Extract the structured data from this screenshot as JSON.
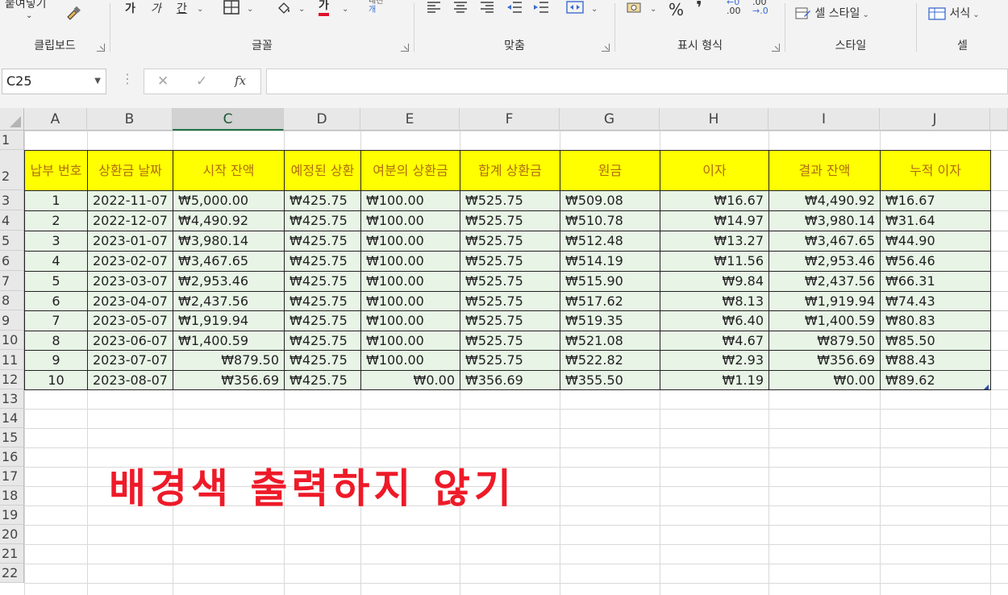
{
  "ribbon": {
    "paste_label": "붙여넣기",
    "groups": {
      "clipboard": "클립보드",
      "font": "글꼴",
      "alignment": "맞춤",
      "number": "표시 형식",
      "styles": "스타일",
      "cells": "셀"
    },
    "font_buttons": {
      "bold": "가",
      "italic": "가",
      "underline": "간",
      "font_color": "가"
    },
    "wrap_label": "내천",
    "number_buttons": {
      "percent": "%",
      "comma": "❜",
      "inc_decimal": ".00",
      "dec_decimal": ".00"
    },
    "cell_style_label": "셀 스타일",
    "format_label": "서식"
  },
  "formula_bar": {
    "name_box": "C25",
    "fx": "fx",
    "cancel": "✕",
    "enter": "✓",
    "value": ""
  },
  "columns": [
    "A",
    "B",
    "C",
    "D",
    "E",
    "F",
    "G",
    "H",
    "I",
    "J"
  ],
  "selected_column": "C",
  "rows": [
    "1",
    "2",
    "3",
    "4",
    "5",
    "6",
    "7",
    "8",
    "9",
    "10",
    "11",
    "12",
    "13",
    "14",
    "15",
    "16",
    "17",
    "18",
    "19",
    "20",
    "21",
    "22"
  ],
  "table": {
    "headers": [
      "납부 번호",
      "상환금 날짜",
      "시작 잔액",
      "예정된 상환",
      "여분의 상환금",
      "합계 상환금",
      "원금",
      "이자",
      "결과 잔액",
      "누적 이자"
    ],
    "rows": [
      [
        "1",
        "2022-11-07",
        "₩5,000.00",
        "₩425.75",
        "₩100.00",
        "₩525.75",
        "₩509.08",
        "₩16.67",
        "₩4,490.92",
        "₩16.67"
      ],
      [
        "2",
        "2022-12-07",
        "₩4,490.92",
        "₩425.75",
        "₩100.00",
        "₩525.75",
        "₩510.78",
        "₩14.97",
        "₩3,980.14",
        "₩31.64"
      ],
      [
        "3",
        "2023-01-07",
        "₩3,980.14",
        "₩425.75",
        "₩100.00",
        "₩525.75",
        "₩512.48",
        "₩13.27",
        "₩3,467.65",
        "₩44.90"
      ],
      [
        "4",
        "2023-02-07",
        "₩3,467.65",
        "₩425.75",
        "₩100.00",
        "₩525.75",
        "₩514.19",
        "₩11.56",
        "₩2,953.46",
        "₩56.46"
      ],
      [
        "5",
        "2023-03-07",
        "₩2,953.46",
        "₩425.75",
        "₩100.00",
        "₩525.75",
        "₩515.90",
        "₩9.84",
        "₩2,437.56",
        "₩66.31"
      ],
      [
        "6",
        "2023-04-07",
        "₩2,437.56",
        "₩425.75",
        "₩100.00",
        "₩525.75",
        "₩517.62",
        "₩8.13",
        "₩1,919.94",
        "₩74.43"
      ],
      [
        "7",
        "2023-05-07",
        "₩1,919.94",
        "₩425.75",
        "₩100.00",
        "₩525.75",
        "₩519.35",
        "₩6.40",
        "₩1,400.59",
        "₩80.83"
      ],
      [
        "8",
        "2023-06-07",
        "₩1,400.59",
        "₩425.75",
        "₩100.00",
        "₩525.75",
        "₩521.08",
        "₩4.67",
        "₩879.50",
        "₩85.50"
      ],
      [
        "9",
        "2023-07-07",
        "₩879.50",
        "₩425.75",
        "₩100.00",
        "₩525.75",
        "₩522.82",
        "₩2.93",
        "₩356.69",
        "₩88.43"
      ],
      [
        "10",
        "2023-08-07",
        "₩356.69",
        "₩425.75",
        "₩0.00",
        "₩356.69",
        "₩355.50",
        "₩1.19",
        "₩0.00",
        "₩89.62"
      ]
    ]
  },
  "annotation": "배경색 출력하지 않기",
  "colors": {
    "header_fill": "#ffff00",
    "header_text": "#b06d10",
    "data_fill": "#e8f4e6",
    "annotation": "#ee1a28",
    "selection": "#217346",
    "trace_arrow": "#1f1fd0"
  }
}
